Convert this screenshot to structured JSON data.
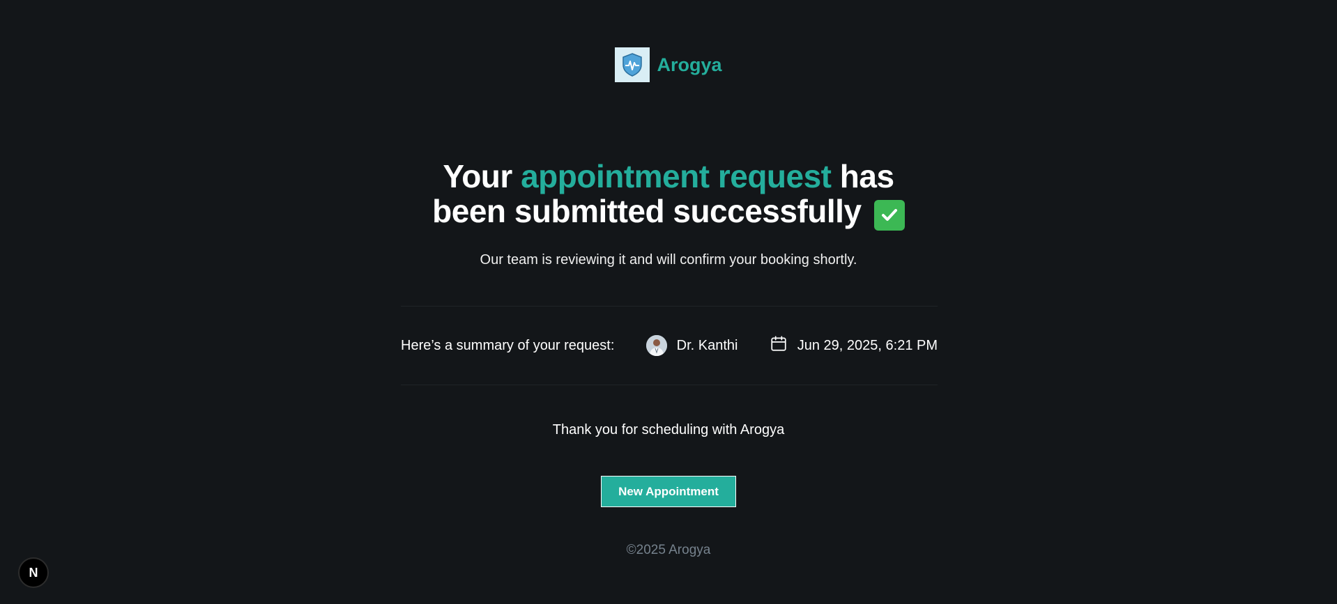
{
  "brand": {
    "name": "Arogya",
    "logo_icon": "shield-heartbeat-icon"
  },
  "headline": {
    "prefix": "Your",
    "highlight": "appointment request",
    "suffix_line1": "has",
    "line2": "been submitted successfully",
    "emoji_icon": "check-mark-button-icon"
  },
  "subtext": "Our team is reviewing it and will confirm your booking shortly.",
  "summary": {
    "label": "Here’s a summary of your request:",
    "doctor_name": "Dr. Kanthi",
    "datetime": "Jun 29, 2025, 6:21 PM",
    "calendar_icon": "calendar-icon"
  },
  "thanks": "Thank you for scheduling with Arogya",
  "new_appointment_button": "New Appointment",
  "footer": {
    "copyright": "©2025 Arogya"
  },
  "dev_badge": {
    "letter": "N"
  },
  "colors": {
    "background": "#131619",
    "accent": "#24ae9c",
    "muted": "#76828d"
  }
}
